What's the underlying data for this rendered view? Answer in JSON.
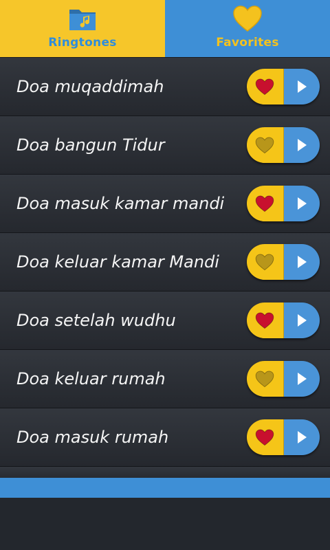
{
  "tabs": {
    "ringtones": {
      "label": "Ringtones",
      "icon": "music-folder-icon",
      "active": true
    },
    "favorites": {
      "label": "Favorites",
      "icon": "heart-icon",
      "active": false
    }
  },
  "colors": {
    "yellow": "#f6c62a",
    "blue": "#3e8fd6",
    "heart_active": "#c8102e",
    "heart_inactive": "#b8961a",
    "background": "#23272d"
  },
  "items": [
    {
      "title": "Doa muqaddimah",
      "favorite": true
    },
    {
      "title": "Doa bangun Tidur",
      "favorite": false
    },
    {
      "title": "Doa masuk kamar mandi",
      "favorite": true
    },
    {
      "title": "Doa keluar kamar Mandi",
      "favorite": false
    },
    {
      "title": "Doa setelah wudhu",
      "favorite": true
    },
    {
      "title": "Doa keluar rumah",
      "favorite": false
    },
    {
      "title": "Doa masuk rumah",
      "favorite": true
    }
  ]
}
